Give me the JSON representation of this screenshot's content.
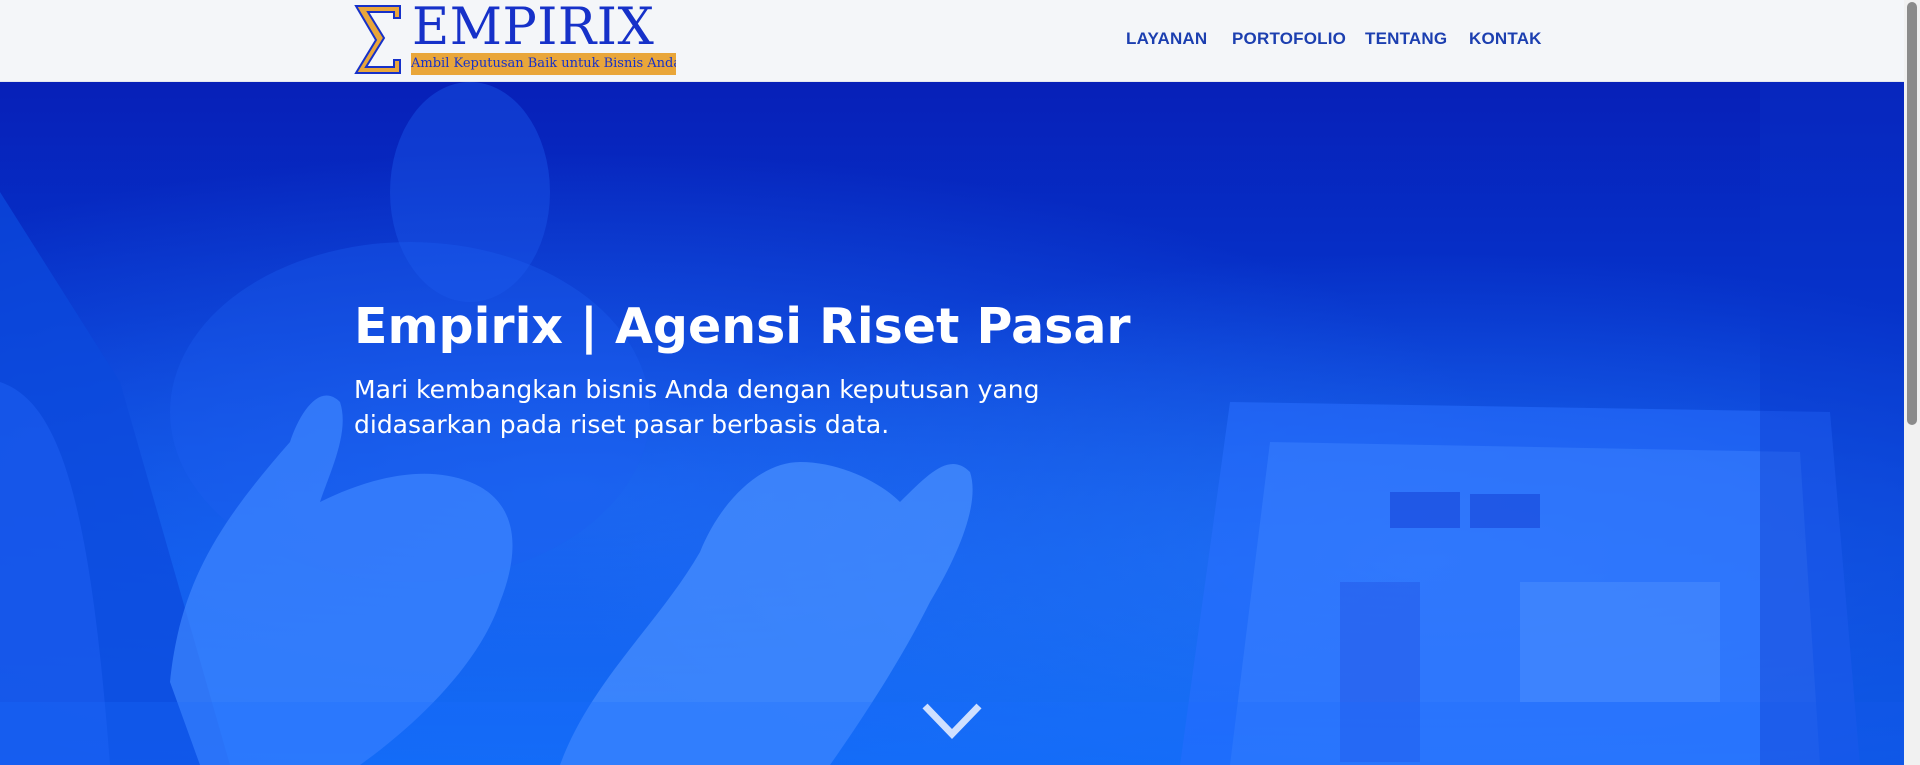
{
  "brand": {
    "name": "EMPIRIX",
    "tagline": "Ambil Keputusan Baik untuk Bisnis Anda!",
    "colors": {
      "blue": "#1631c9",
      "gold": "#e9a63a"
    }
  },
  "nav": {
    "items": [
      {
        "label": "LAYANAN"
      },
      {
        "label": "PORTOFOLIO"
      },
      {
        "label": "TENTANG"
      },
      {
        "label": "KONTAK"
      }
    ]
  },
  "hero": {
    "title": "Empirix | Agensi Riset Pasar",
    "subtitle": "Mari kembangkan bisnis Anda dengan keputusan yang didasarkan pada riset pasar berbasis data.",
    "scroll_icon": "chevron-down-icon",
    "overlay_color": "#0634cc"
  }
}
